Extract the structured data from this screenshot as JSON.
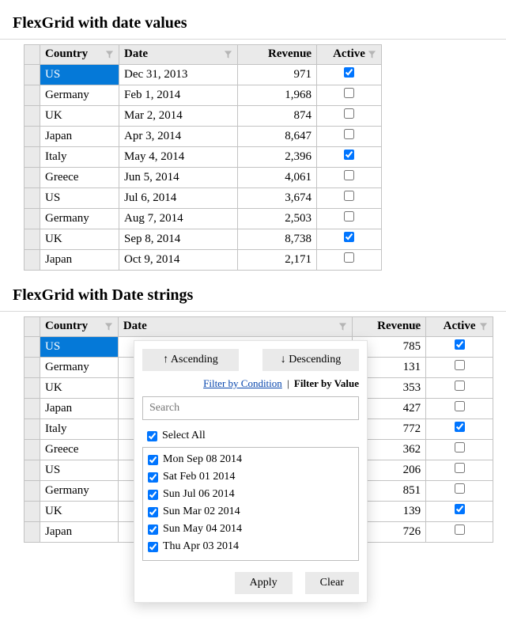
{
  "headings": {
    "h1": "FlexGrid with date values",
    "h2": "FlexGrid with Date strings"
  },
  "columns": {
    "country": "Country",
    "date": "Date",
    "revenue": "Revenue",
    "active": "Active"
  },
  "grid1": {
    "rows": [
      {
        "country": "US",
        "date": "Dec 31, 2013",
        "revenue": "971",
        "active": true
      },
      {
        "country": "Germany",
        "date": "Feb 1, 2014",
        "revenue": "1,968",
        "active": false
      },
      {
        "country": "UK",
        "date": "Mar 2, 2014",
        "revenue": "874",
        "active": false
      },
      {
        "country": "Japan",
        "date": "Apr 3, 2014",
        "revenue": "8,647",
        "active": false
      },
      {
        "country": "Italy",
        "date": "May 4, 2014",
        "revenue": "2,396",
        "active": true
      },
      {
        "country": "Greece",
        "date": "Jun 5, 2014",
        "revenue": "4,061",
        "active": false
      },
      {
        "country": "US",
        "date": "Jul 6, 2014",
        "revenue": "3,674",
        "active": false
      },
      {
        "country": "Germany",
        "date": "Aug 7, 2014",
        "revenue": "2,503",
        "active": false
      },
      {
        "country": "UK",
        "date": "Sep 8, 2014",
        "revenue": "8,738",
        "active": true
      },
      {
        "country": "Japan",
        "date": "Oct 9, 2014",
        "revenue": "2,171",
        "active": false
      }
    ]
  },
  "grid2": {
    "rows": [
      {
        "country": "US",
        "revenue": "785",
        "active": true
      },
      {
        "country": "Germany",
        "revenue": "131",
        "active": false
      },
      {
        "country": "UK",
        "revenue": "353",
        "active": false
      },
      {
        "country": "Japan",
        "revenue": "427",
        "active": false
      },
      {
        "country": "Italy",
        "revenue": "772",
        "active": true
      },
      {
        "country": "Greece",
        "revenue": "362",
        "active": false
      },
      {
        "country": "US",
        "revenue": "206",
        "active": false
      },
      {
        "country": "Germany",
        "revenue": "851",
        "active": false
      },
      {
        "country": "UK",
        "revenue": "139",
        "active": true
      },
      {
        "country": "Japan",
        "revenue": "726",
        "active": false
      }
    ]
  },
  "filter": {
    "asc": "↑ Ascending",
    "desc": "↓ Descending",
    "by_condition": "Filter by Condition",
    "by_value": "Filter by Value",
    "search_placeholder": "Search",
    "select_all": "Select All",
    "apply": "Apply",
    "clear": "Clear",
    "values": [
      "Mon Sep 08 2014",
      "Sat Feb 01 2014",
      "Sun Jul 06 2014",
      "Sun Mar 02 2014",
      "Sun May 04 2014",
      "Thu Apr 03 2014"
    ]
  }
}
